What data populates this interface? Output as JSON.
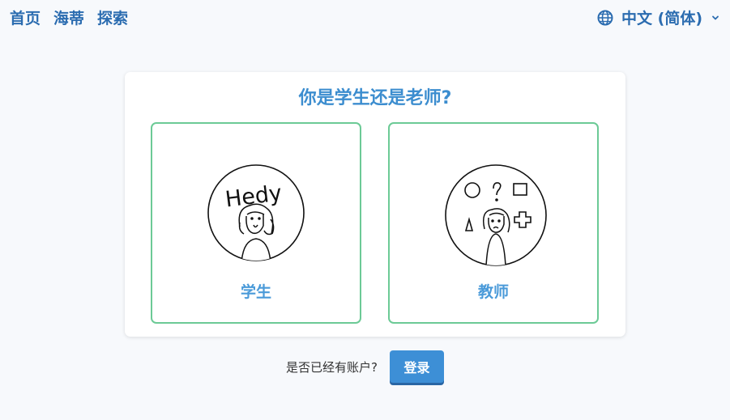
{
  "nav": {
    "items": [
      {
        "label": "首页"
      },
      {
        "label": "海蒂"
      },
      {
        "label": "探索"
      }
    ]
  },
  "language": {
    "label": "中文 (简体)",
    "icon": "globe-icon",
    "chevron": "chevron-down-icon"
  },
  "card": {
    "title": "你是学生还是老师?",
    "student_label": "学生",
    "teacher_label": "教师",
    "student_sign": "Hedy"
  },
  "footer": {
    "question": "是否已经有账户?",
    "login_label": "登录"
  },
  "colors": {
    "primary": "#2b6cb0",
    "title": "#3c8dcf",
    "option_border": "#6cca96",
    "button": "#3d8fd6"
  }
}
